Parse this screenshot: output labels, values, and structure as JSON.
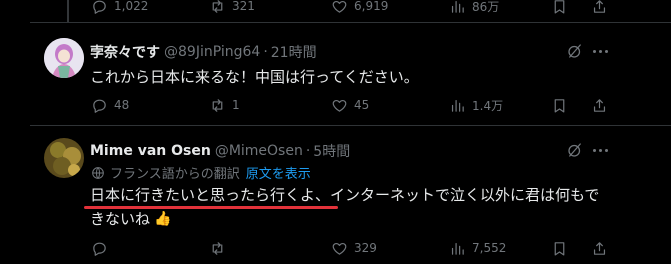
{
  "top_actions": {
    "replies": "1,022",
    "reposts": "321",
    "likes": "6,919",
    "views": "86万"
  },
  "tweets": [
    {
      "name": "孛奈々です",
      "handle": "@89JinPing64",
      "time": "21時間",
      "text": "これから日本に来るな！中国は行ってください。",
      "replies": "48",
      "reposts": "1",
      "likes": "45",
      "views": "1.4万"
    },
    {
      "name": "Mime van Osen",
      "handle": "@MimeOsen",
      "time": "5時間",
      "translation_note": "フランス語からの翻訳",
      "show_original": "原文を表示",
      "text_line1": "日本に行きたいと思ったら行くよ、インターネットで泣く以外に君は何もで",
      "text_line2": "きないね",
      "emoji": "👍",
      "replies": "",
      "reposts": "",
      "likes": "329",
      "views": "7,552"
    }
  ],
  "colors": {
    "background": "#000000",
    "text": "#e7e9ea",
    "muted": "#71767b",
    "link": "#1d9bf0",
    "underline": "#e2323a"
  },
  "icons": [
    "reply-icon",
    "repost-icon",
    "like-icon",
    "views-icon",
    "bookmark-icon",
    "share-icon",
    "grok-icon",
    "more-icon",
    "translate-icon"
  ]
}
